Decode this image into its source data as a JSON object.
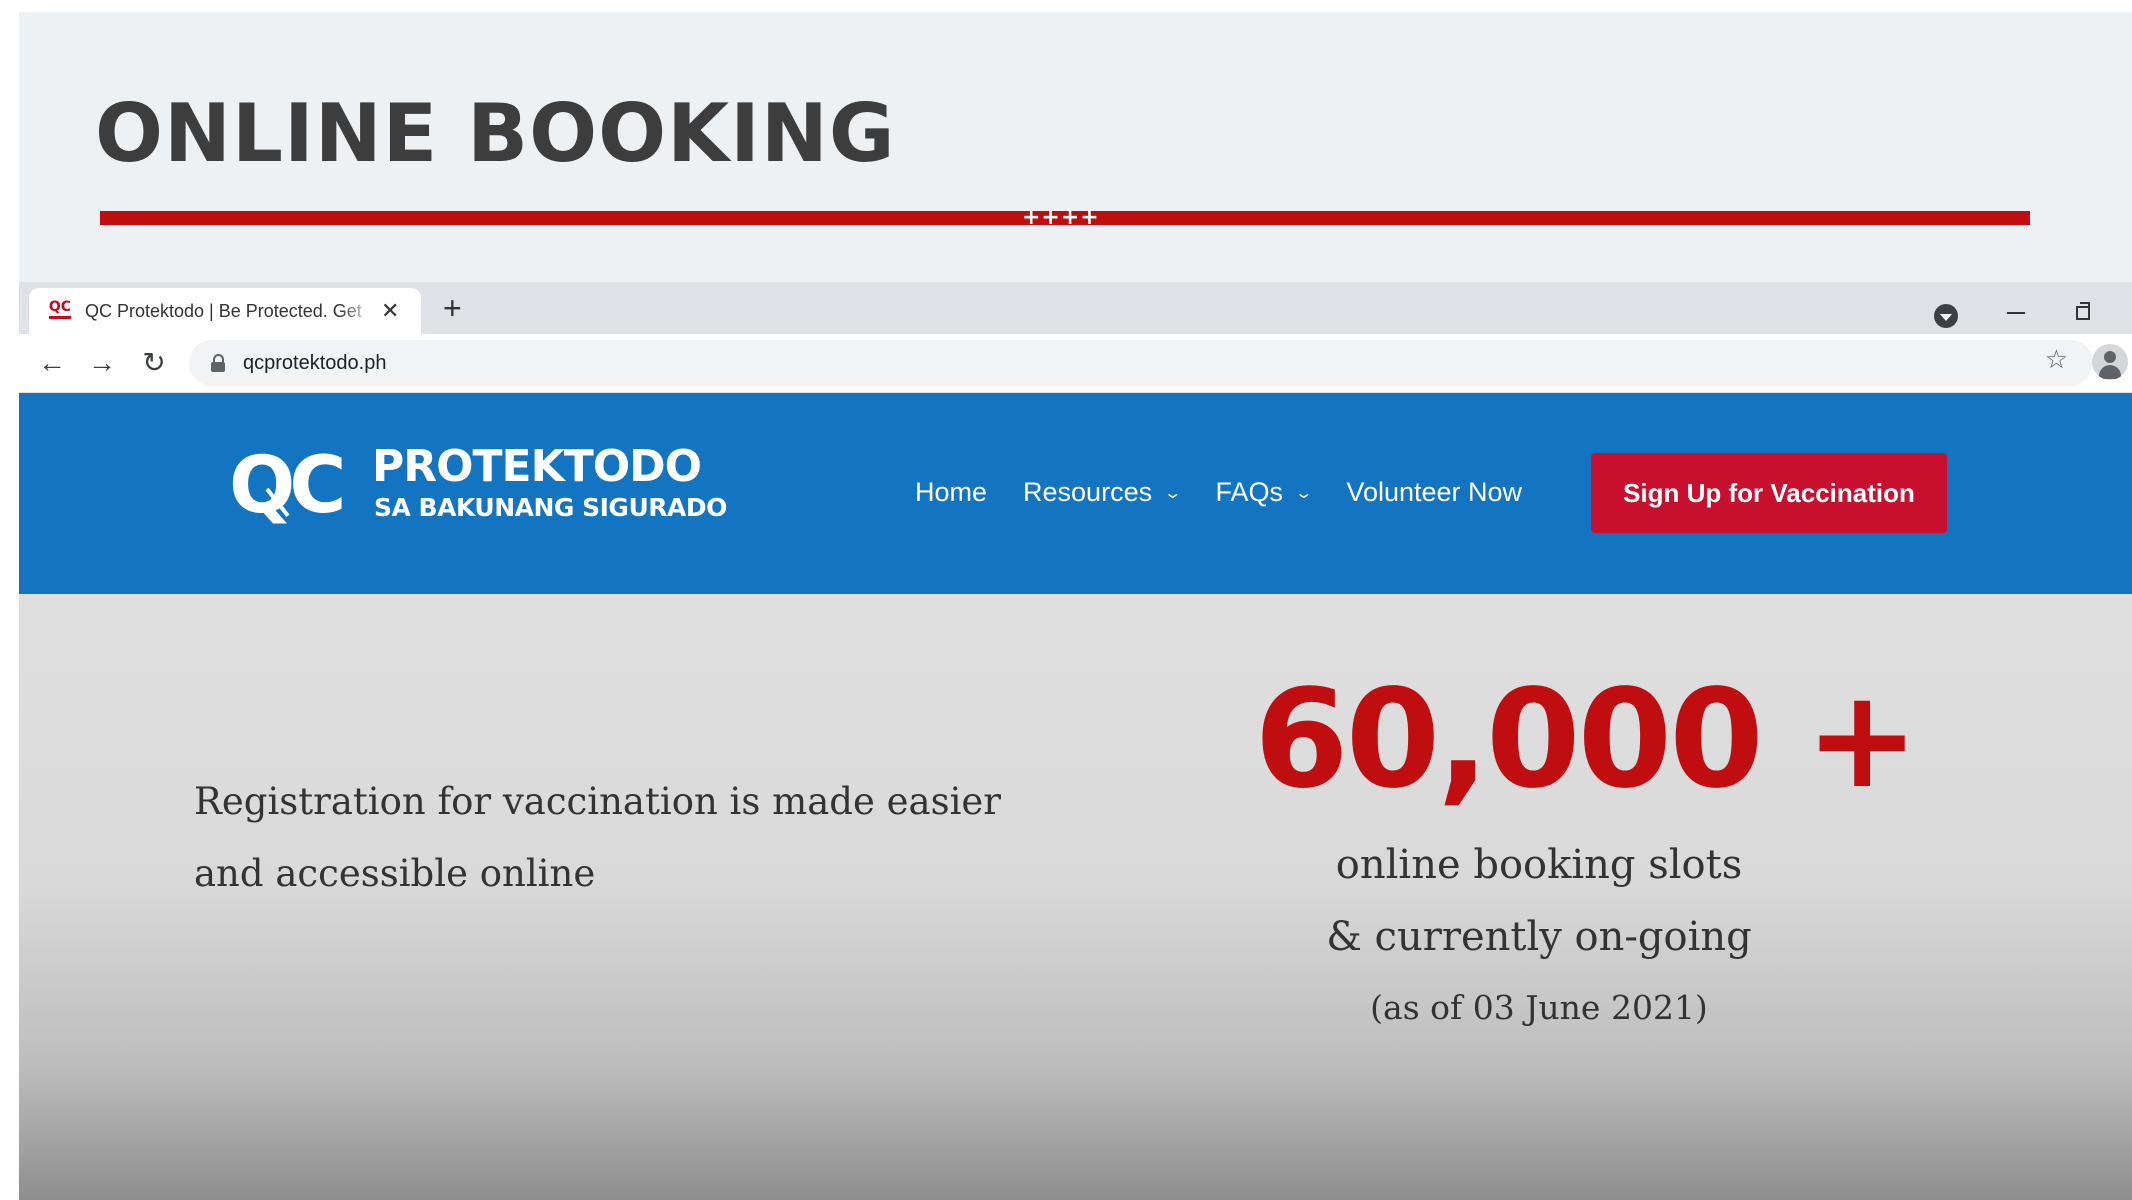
{
  "slide": {
    "title": "ONLINE BOOKING",
    "rule_marks": "++++",
    "accent_color": "#c00d10"
  },
  "browser": {
    "tab": {
      "favicon_text": "QC",
      "title": "QC Protektodo | Be Protected. Get",
      "close_icon": "close-icon"
    },
    "new_tab_label": "+",
    "nav_icons": [
      "back-arrow-icon",
      "forward-arrow-icon",
      "reload-icon"
    ],
    "url": "qcprotektodo.ph",
    "bookmark_icon": "star-icon",
    "profile_icon": "avatar-icon"
  },
  "site": {
    "brand_color": "#1375c2",
    "logo": {
      "mark": "QC",
      "line1": "PROTEKTODO",
      "line2": "SA BAKUNANG SIGURADO"
    },
    "nav": {
      "home": "Home",
      "resources": "Resources",
      "faqs": "FAQs",
      "volunteer": "Volunteer Now"
    },
    "cta": {
      "label": "Sign Up for Vaccination",
      "color": "#c8102e"
    }
  },
  "content": {
    "lead": "Registration for vaccination is made easier and accessible online",
    "stat": {
      "number": "60,000 +",
      "line1": "online booking slots",
      "line2": "& currently on-going",
      "line3": "(as of 03 June 2021)"
    }
  }
}
